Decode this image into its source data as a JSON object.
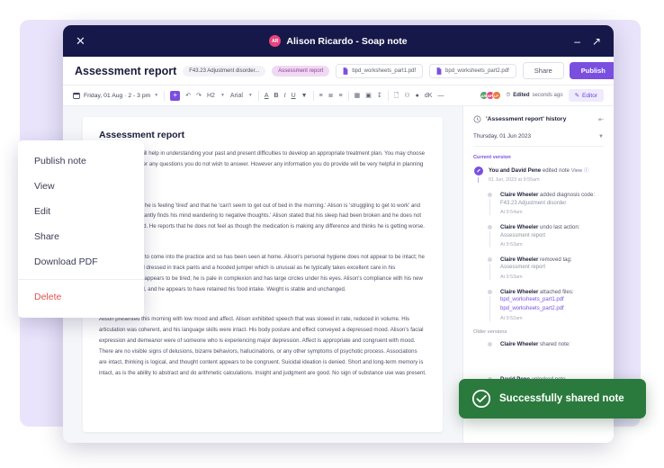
{
  "titlebar": {
    "close_icon": "close-icon",
    "avatar_initials": "AR",
    "title": "Alison Ricardo - Soap note",
    "minimize_icon": "minimize-icon",
    "expand_icon": "expand-icon"
  },
  "header": {
    "doc_title": "Assessment report",
    "code_chip": "F43.23 Adjustment disorder...",
    "tag_chip": "Assessment report",
    "files": [
      {
        "name": "bpd_worksheets_part1.pdf"
      },
      {
        "name": "bpd_worksheets_part2.pdf"
      }
    ],
    "share_label": "Share",
    "publish_label": "Publish"
  },
  "toolbar": {
    "date": "Friday, 01 Aug · 2 - 3 pm",
    "add_label": "+",
    "undo_icon": "undo-icon",
    "redo_icon": "redo-icon",
    "heading_select": "H2",
    "font_select": "Arial",
    "text_color_label": "A",
    "bold_label": "B",
    "italic_label": "I",
    "underline_label": "U",
    "highlight_label": "▼",
    "bullet_list_icon": "bullet-list-icon",
    "numbered_list_icon": "numbered-list-icon",
    "align_icon": "align-icon",
    "table_icon": "table-icon",
    "image_icon": "image-icon",
    "download_icon": "download-icon",
    "file_icon": "file-icon",
    "link_icon": "link-icon",
    "record_icon": "record-icon",
    "clear_format_label": "dK",
    "divider_icon": "divider-icon",
    "collaborators": [
      "AR",
      "MF",
      "LP"
    ],
    "edited_prefix": "Edited",
    "edited_value": "seconds ago",
    "editor_label": "Editor"
  },
  "document": {
    "title": "Assessment report",
    "intro": "This information will help in understanding your past and present difficulties to develop an appropriate treatment plan. You may choose to decline to answer any questions you do not wish to answer. However any information you do provide will be very helpful in planning your care...",
    "sections": [
      {
        "label": "Subjective:",
        "text": "Alison reports that he is feeling 'tired' and that he 'can't seem to get out of bed in the morning.' Alison is 'struggling to get to work' and says that he 'constantly finds his mind wandering to negative thoughts.' Alison stated that his sleep had been broken and he does not wake feeling rested. He reports that he does not feel as though the medication is making any difference and thinks he is getting worse."
      },
      {
        "label": "Objective:",
        "text": "Alison was unable to come into the practice and so has been seen at home. Alison's personal hygiene does not appear to be intact; he was unshaven and dressed in track pants and a hooded jumper which is unusual as he typically takes excellent care in his appearance. John appears to be tired; he is pale in complexion and has large circles under his eyes. Alison's compliance with his new medication is good, and he appears to have retained his food intake. Weight is stable and unchanged."
      },
      {
        "label": "Assessment:",
        "text": "Alison presented this morning with low mood and affect. Alison exhibited speech that was slowed in rate, reduced in volume. His articulation was coherent, and his language skills were intact. His body posture and effect conveyed a depressed mood. Alison's facial expression and demeanor were of someone who is experiencing major depression. Affect is appropriate and congruent with mood. There are no visible signs of delusions, bizarre behaviors, hallucinations, or any other symptoms of psychotic process. Associations are intact, thinking is logical, and thought content appears to be congruent. Suicidal ideation is denied. Short and long-term memory is intact, as is the ability to abstract and do arithmetic calculations. Insight and judgment are good. No sign of substance use was present."
      }
    ]
  },
  "history": {
    "panel_title": "'Assessment report' history",
    "collapse_icon": "collapse-panel-icon",
    "date_group": "Thursday, 01 Jun 2023",
    "current_version_label": "Current version",
    "older_versions_label": "Older versions",
    "entries": [
      {
        "actor": "You and David Pene",
        "action": "edited note",
        "view_label": "View",
        "time": "01 Jun, 2023 at 9:55am",
        "type": "primary"
      },
      {
        "actor": "Claire Wheeler",
        "action": "added diagnosis code:",
        "detail": "F43.23 Adjustment disorder",
        "time": "At 9:54am",
        "type": "sub"
      },
      {
        "actor": "Claire Wheeler",
        "action": "undo last action:",
        "detail": "Assessment report",
        "time": "At 9:53am",
        "type": "sub"
      },
      {
        "actor": "Claire Wheeler",
        "action": "removed tag:",
        "detail": "Assessment report",
        "time": "At 9:53am",
        "type": "sub"
      },
      {
        "actor": "Claire Wheeler",
        "action": "attached files:",
        "links": [
          "bpd_worksheets_part1.pdf",
          "bpd_worksheets_part2.pdf"
        ],
        "time": "At 9:52am",
        "type": "sub"
      },
      {
        "actor": "Claire Wheeler",
        "action": "shared note:",
        "type": "older"
      },
      {
        "actor": "David Pene",
        "action": "unlocked note",
        "type": "older"
      }
    ]
  },
  "toast": {
    "icon": "check-circle-icon",
    "message": "Successfully shared note"
  },
  "context_menu": {
    "items": [
      {
        "label": "Publish note",
        "danger": false
      },
      {
        "label": "View",
        "danger": false
      },
      {
        "label": "Edit",
        "danger": false
      },
      {
        "label": "Share",
        "danger": false
      },
      {
        "label": "Download PDF",
        "danger": false
      },
      {
        "label": "Delete",
        "danger": true
      }
    ]
  },
  "colors": {
    "titlebar": "#16184a",
    "accent": "#7a4fe0",
    "toast": "#2b7a3d",
    "backdrop": "#e9e4fb",
    "danger": "#e05252",
    "tag": "#f0d9f2"
  }
}
